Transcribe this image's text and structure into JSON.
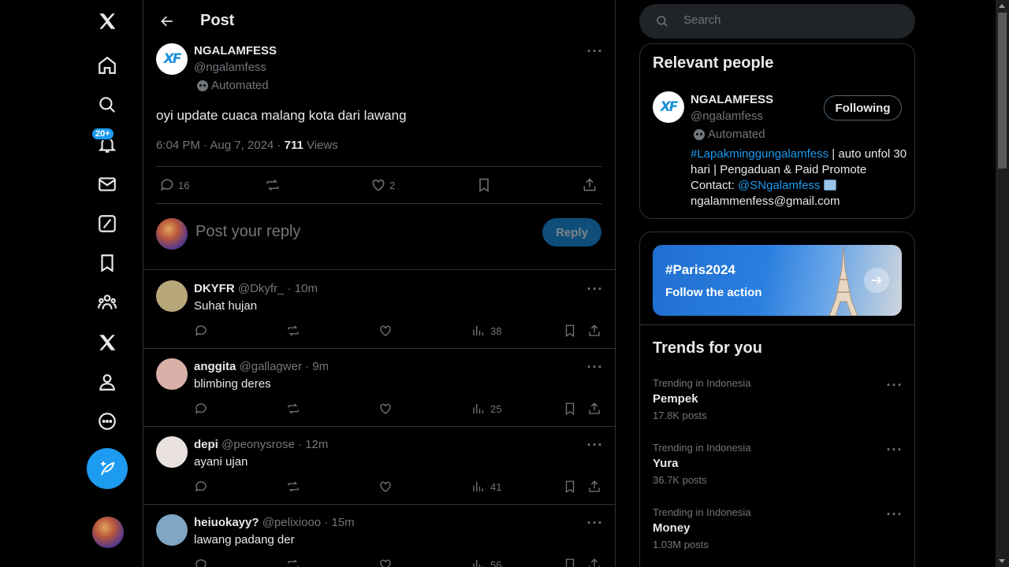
{
  "nav": {
    "notifications_badge": "20+"
  },
  "header": {
    "title": "Post"
  },
  "post": {
    "name": "NGALAMFESS",
    "handle": "@ngalamfess",
    "automated": "Automated",
    "avatar_text": "XF",
    "text": "oyi update cuaca malang kota dari lawang",
    "time": "6:04 PM · Aug 7, 2024 · ",
    "views_count": "711",
    "views_label": " Views",
    "replies": "16",
    "likes": "2"
  },
  "reply_box": {
    "placeholder": "Post your reply",
    "button": "Reply"
  },
  "replies": [
    {
      "name": "DKYFR",
      "handle": "@Dkyfr_",
      "time": "· 10m",
      "text": "Suhat hujan",
      "views": "38",
      "avatar_color": "#b8a77a"
    },
    {
      "name": "anggita",
      "handle": "@gallagwer",
      "time": "· 9m",
      "text": "blimbing deres",
      "views": "25",
      "avatar_color": "#d9b0a8"
    },
    {
      "name": "depi",
      "handle": "@peonysrose",
      "time": "· 12m",
      "text": "ayani ujan",
      "views": "41",
      "avatar_color": "#e9e2df"
    },
    {
      "name": "heiuokayy?",
      "handle": "@pelixiooo",
      "time": "· 15m",
      "text": "lawang padang der",
      "views": "56",
      "avatar_color": "#7fa6c4"
    }
  ],
  "search": {
    "placeholder": "Search"
  },
  "relevant": {
    "title": "Relevant people",
    "name": "NGALAMFESS",
    "handle": "@ngalamfess",
    "automated": "Automated",
    "follow_button": "Following",
    "bio_link1": "#Lapakminggungalamfess",
    "bio_text1": " | auto unfol 30 hari | Pengaduan & Paid Promote Contact: ",
    "bio_link2": "@SNgalamfess",
    "bio_text2": " ngalammenfess@gmail.com"
  },
  "promo": {
    "tag": "#Paris2024",
    "subtitle": "Follow the action"
  },
  "trends": {
    "title": "Trends for you",
    "items": [
      {
        "context": "Trending in Indonesia",
        "name": "Pempek",
        "count": "17.8K posts"
      },
      {
        "context": "Trending in Indonesia",
        "name": "Yura",
        "count": "36.7K posts"
      },
      {
        "context": "Trending in Indonesia",
        "name": "Money",
        "count": "1.03M posts"
      }
    ]
  },
  "colors": {
    "accent": "#1d9bf0",
    "background": "#000000",
    "border": "#2f3336",
    "muted": "#71767b"
  }
}
